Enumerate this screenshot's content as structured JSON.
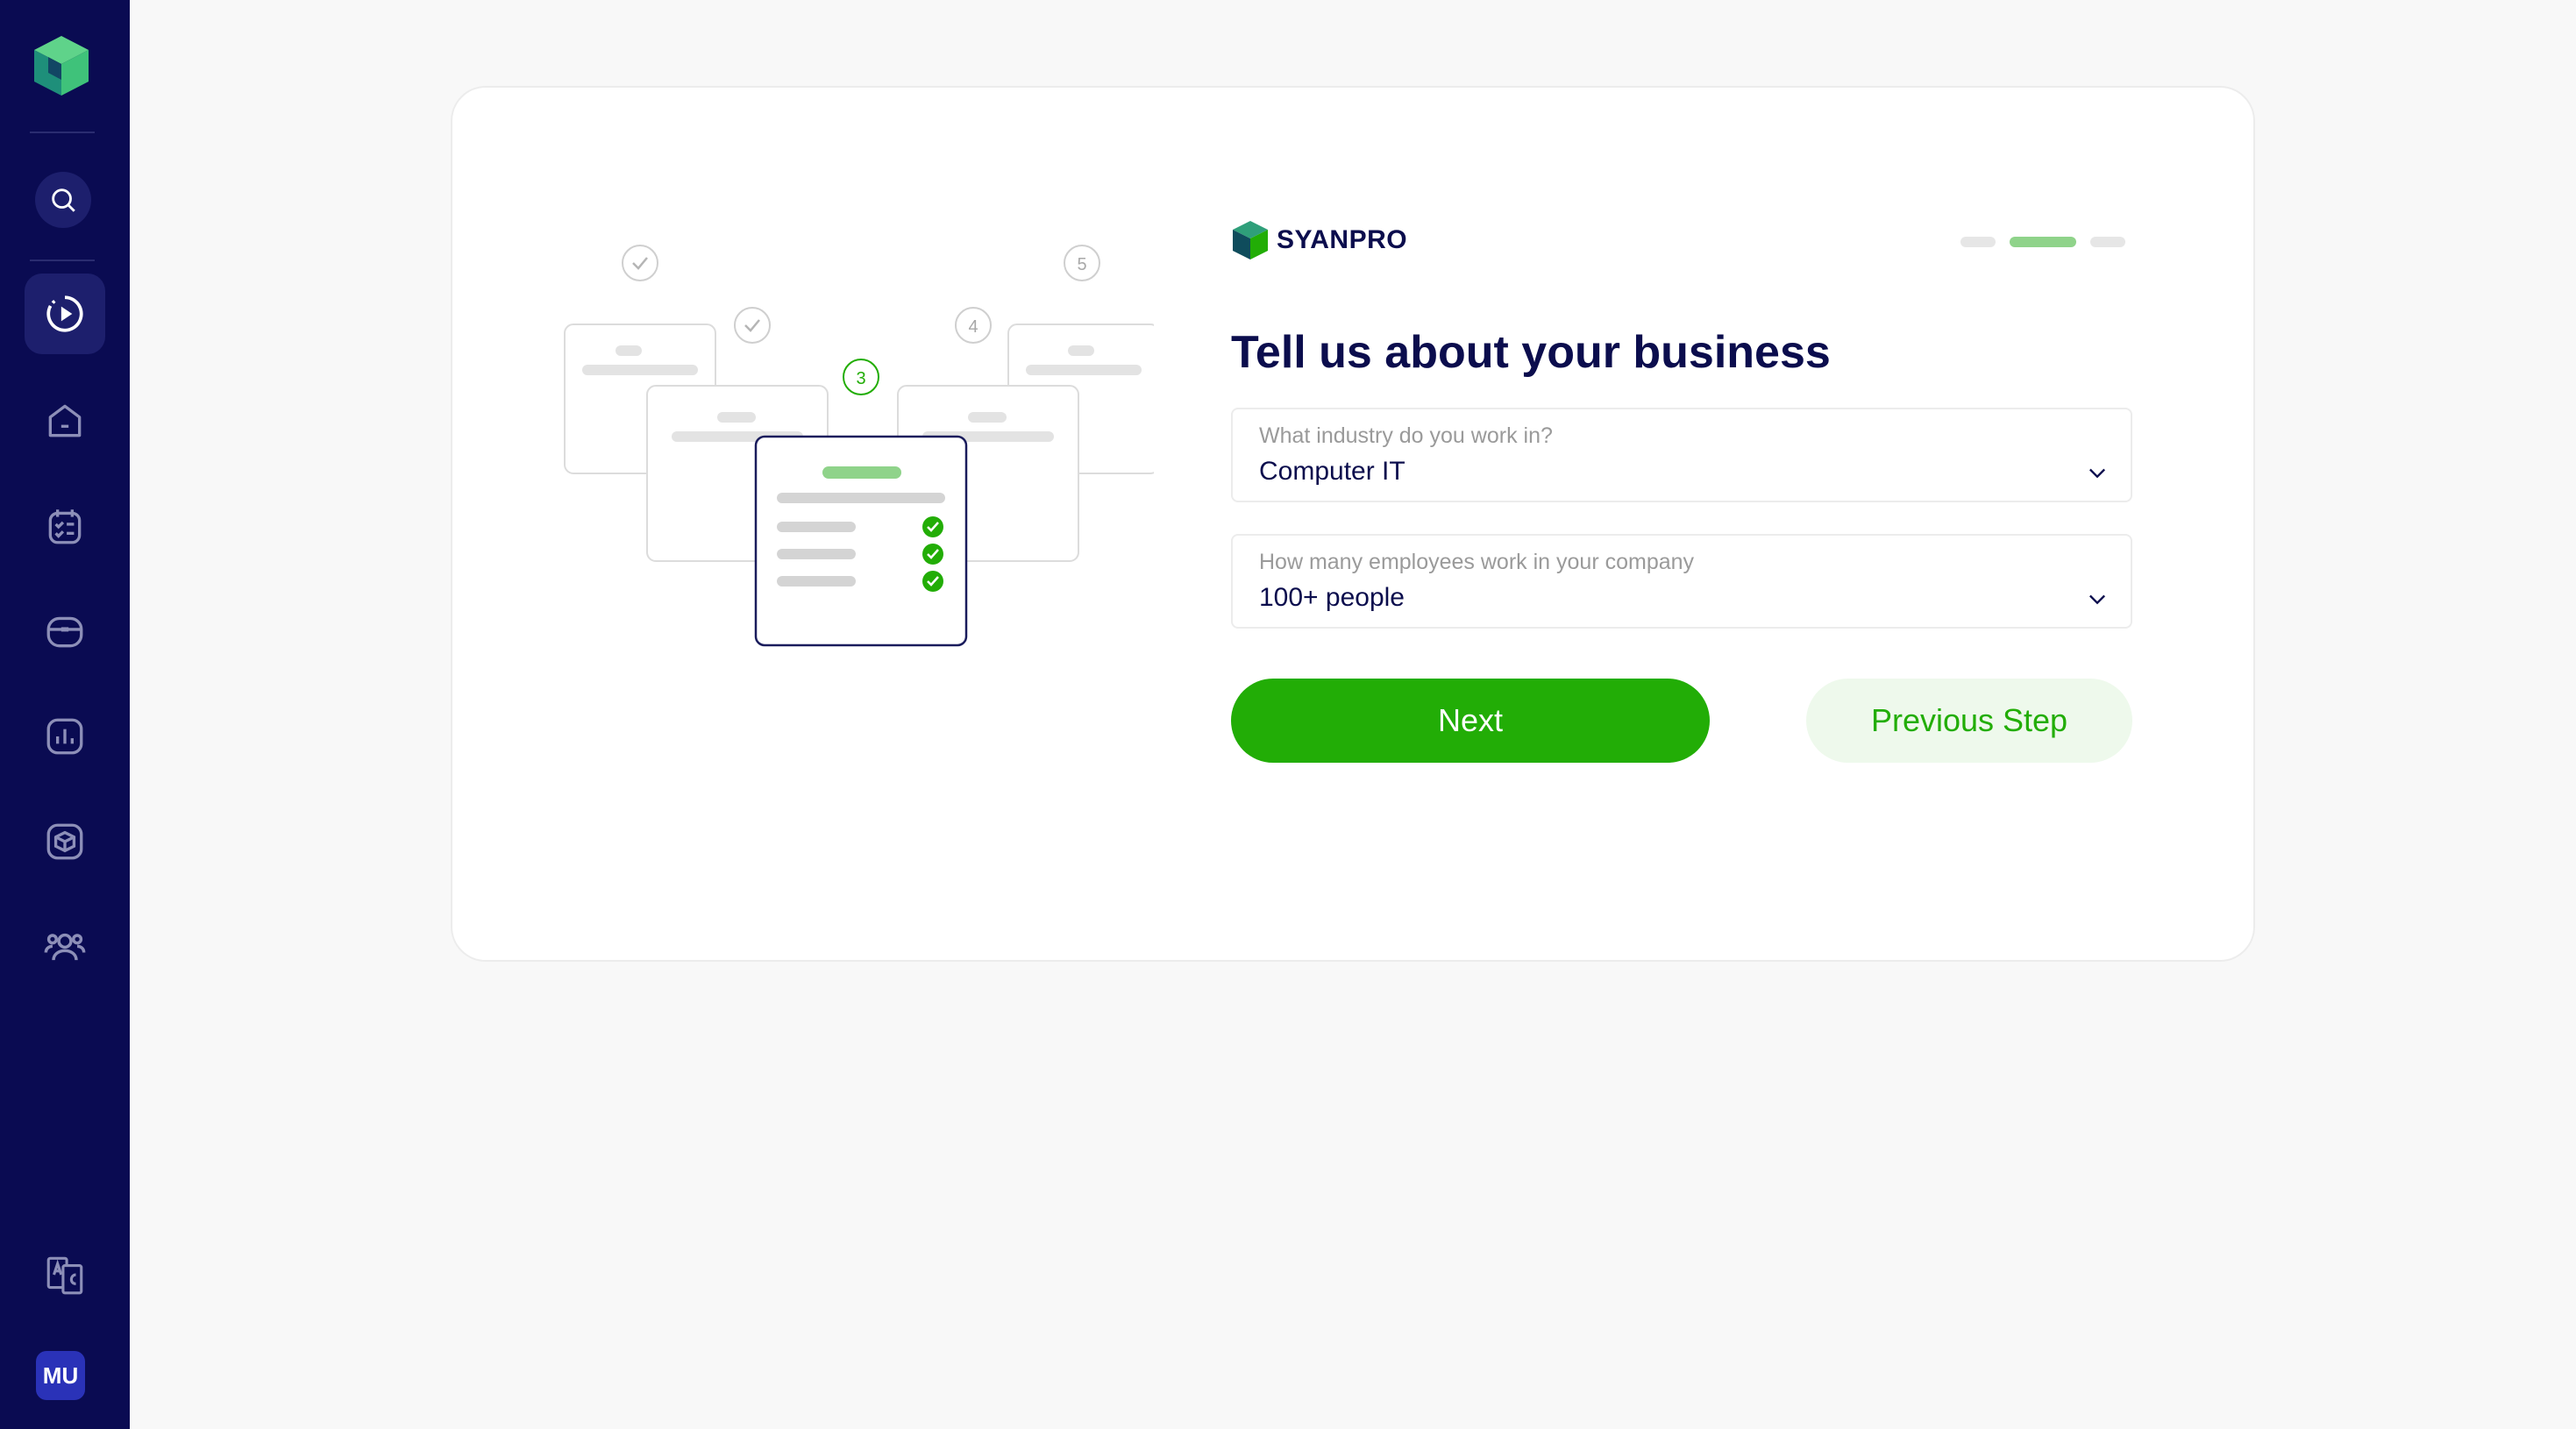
{
  "sidebar": {
    "search_icon": "search-icon",
    "items": [
      {
        "icon": "play-progress-icon",
        "active": true
      },
      {
        "icon": "home-icon",
        "active": false
      },
      {
        "icon": "checklist-icon",
        "active": false
      },
      {
        "icon": "wallet-icon",
        "active": false
      },
      {
        "icon": "chart-icon",
        "active": false
      },
      {
        "icon": "package-icon",
        "active": false
      },
      {
        "icon": "users-icon",
        "active": false
      }
    ],
    "bottom_icon": "translate-icon",
    "avatar_initials": "MU"
  },
  "brand": {
    "name": "SYANPRO"
  },
  "stepper": {
    "total": 3,
    "current": 2
  },
  "illustration": {
    "step_numbers": [
      "3",
      "4",
      "5"
    ]
  },
  "form": {
    "heading": "Tell us about your business",
    "industry": {
      "label": "What industry do you work in?",
      "value": "Computer IT"
    },
    "employees": {
      "label": "How many employees work in your company",
      "value": "100+ people"
    },
    "next_label": "Next",
    "previous_label": "Previous Step"
  },
  "colors": {
    "sidebar_bg": "#0a0b52",
    "accent_green": "#22ad06",
    "text_dark": "#0b0d4d"
  }
}
